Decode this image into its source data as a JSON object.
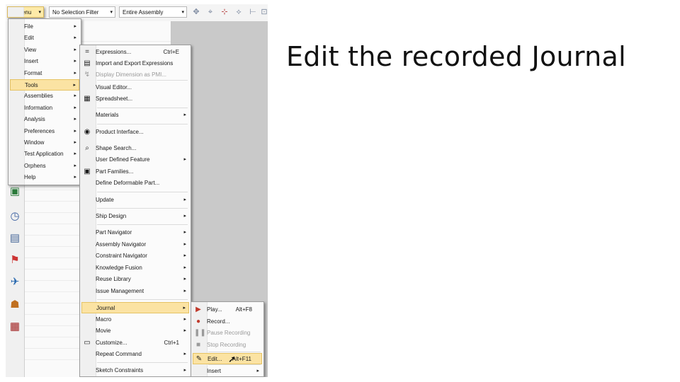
{
  "slide": {
    "title": "Edit the recorded Journal"
  },
  "toolbar": {
    "menu_label": "Menu",
    "selection_filter": "No Selection Filter",
    "scope": "Entire Assembly"
  },
  "main_menu": [
    {
      "label": "File",
      "submenu": true
    },
    {
      "label": "Edit",
      "submenu": true
    },
    {
      "label": "View",
      "submenu": true
    },
    {
      "label": "Insert",
      "submenu": true
    },
    {
      "label": "Format",
      "submenu": true
    },
    {
      "label": "Tools",
      "submenu": true,
      "highlighted": true
    },
    {
      "label": "Assemblies",
      "submenu": true
    },
    {
      "label": "Information",
      "submenu": true
    },
    {
      "label": "Analysis",
      "submenu": true
    },
    {
      "label": "Preferences",
      "submenu": true
    },
    {
      "label": "Window",
      "submenu": true
    },
    {
      "label": "Test Application",
      "submenu": true
    },
    {
      "label": "Orphens",
      "submenu": true
    },
    {
      "label": "Help",
      "submenu": true
    }
  ],
  "tools_menu": [
    {
      "label": "Expressions...",
      "shortcut": "Ctrl+E",
      "icon": "expressions-icon",
      "glyph": "="
    },
    {
      "label": "Import and Export Expressions",
      "icon": "import-export-icon",
      "glyph": "▤"
    },
    {
      "label": "Display Dimension as PMI...",
      "icon": "pmi-icon",
      "glyph": "↯",
      "disabled": true
    },
    {
      "label": "Visual Editor...",
      "icon": "",
      "glyph": ""
    },
    {
      "label": "Spreadsheet...",
      "icon": "spreadsheet-icon",
      "glyph": "▦"
    },
    {
      "label": "Materials",
      "submenu": true
    },
    {
      "label": "Product Interface...",
      "icon": "product-interface-icon",
      "glyph": "◉"
    },
    {
      "label": "Shape Search...",
      "icon": "shape-search-icon",
      "glyph": "⌕"
    },
    {
      "label": "User Defined Feature",
      "submenu": true
    },
    {
      "label": "Part Families...",
      "icon": "part-families-icon",
      "glyph": "▣"
    },
    {
      "label": "Define Deformable Part..."
    },
    {
      "label": "Update",
      "submenu": true
    },
    {
      "label": "Ship Design",
      "submenu": true
    },
    {
      "label": "Part Navigator",
      "submenu": true
    },
    {
      "label": "Assembly Navigator",
      "submenu": true
    },
    {
      "label": "Constraint Navigator",
      "submenu": true
    },
    {
      "label": "Knowledge Fusion",
      "submenu": true
    },
    {
      "label": "Reuse Library",
      "submenu": true
    },
    {
      "label": "Issue Management",
      "submenu": true
    },
    {
      "label": "Journal",
      "submenu": true,
      "highlighted": true
    },
    {
      "label": "Macro",
      "submenu": true
    },
    {
      "label": "Movie",
      "submenu": true
    },
    {
      "label": "Customize...",
      "shortcut": "Ctrl+1",
      "icon": "customize-icon",
      "glyph": "▭"
    },
    {
      "label": "Repeat Command",
      "submenu": true
    },
    {
      "label": "Sketch Constraints",
      "submenu": true
    }
  ],
  "journal_menu": [
    {
      "label": "Play...",
      "shortcut": "Alt+F8",
      "icon": "play-icon",
      "glyph": "▶",
      "color": "#c0392b"
    },
    {
      "label": "Record...",
      "icon": "record-icon",
      "glyph": "●",
      "color": "#c0392b"
    },
    {
      "label": "Pause Recording",
      "icon": "pause-icon",
      "glyph": "❚❚",
      "disabled": true
    },
    {
      "label": "Stop Recording",
      "icon": "stop-icon",
      "glyph": "■",
      "disabled": true
    },
    {
      "label": "Edit...",
      "shortcut": "Alt+F11",
      "icon": "edit-journal-icon",
      "glyph": "✎",
      "highlighted": true
    },
    {
      "label": "Insert",
      "submenu": true
    }
  ]
}
